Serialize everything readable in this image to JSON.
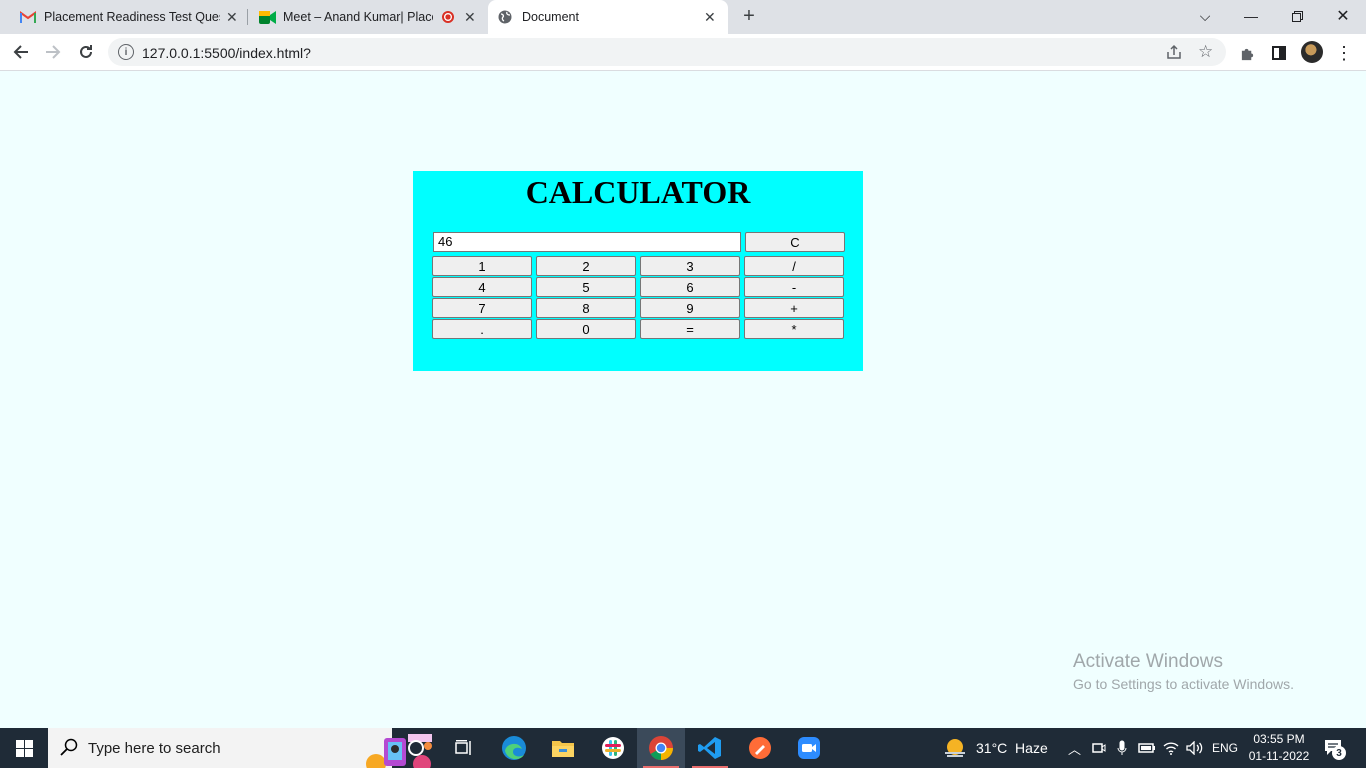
{
  "browser": {
    "tabs": [
      {
        "title": "Placement Readiness Test Questi",
        "icon": "gmail-icon"
      },
      {
        "title": "Meet – Anand Kumar| Placem",
        "icon": "google-meet-icon"
      },
      {
        "title": "Document",
        "icon": "globe-icon"
      }
    ],
    "url": "127.0.0.1:5500/index.html?"
  },
  "calculator": {
    "title": "CALCULATOR",
    "display_value": "46",
    "clear_label": "C",
    "keys": [
      "1",
      "2",
      "3",
      "/",
      "4",
      "5",
      "6",
      "-",
      "7",
      "8",
      "9",
      "+",
      ".",
      "0",
      "=",
      "*"
    ]
  },
  "watermark": {
    "line1": "Activate Windows",
    "line2": "Go to Settings to activate Windows."
  },
  "taskbar": {
    "search_placeholder": "Type here to search",
    "weather": "31°C  Haze",
    "language": "ENG",
    "time": "03:55 PM",
    "date": "01-11-2022",
    "notification_count": "3"
  },
  "colors": {
    "page_bg": "#f0ffff",
    "calc_bg": "#00ffff",
    "taskbar_bg": "#1f2b37"
  }
}
